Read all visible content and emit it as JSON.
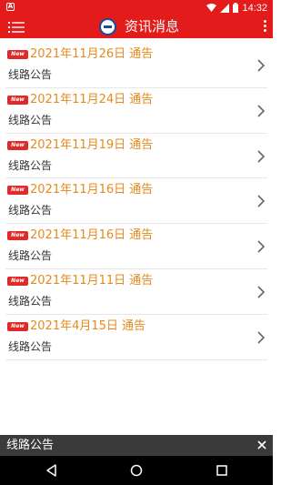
{
  "status_bar": {
    "time": "14:32"
  },
  "app_bar": {
    "title": "资讯消息"
  },
  "colors": {
    "primary": "#e31b1b",
    "title_text": "#e58a1e",
    "badge": "#e02a2a"
  },
  "items": [
    {
      "badge": "New",
      "title": "2021年11月26日  通告",
      "subtitle": "线路公告"
    },
    {
      "badge": "New",
      "title": "2021年11月24日  通告",
      "subtitle": "线路公告"
    },
    {
      "badge": "New",
      "title": "2021年11月19日  通告",
      "subtitle": "线路公告"
    },
    {
      "badge": "New",
      "title": "2021年11月16日  通告",
      "subtitle": "线路公告"
    },
    {
      "badge": "New",
      "title": "2021年11月16日  通告",
      "subtitle": "线路公告"
    },
    {
      "badge": "New",
      "title": "2021年11月11日  通告",
      "subtitle": "线路公告"
    },
    {
      "badge": "New",
      "title": "2021年4月15日  通告",
      "subtitle": "线路公告"
    }
  ],
  "bottom_bar": {
    "text": "线路公告"
  },
  "icons": {
    "menu": "menu-icon",
    "logo": "logo-icon",
    "more": "more-icon",
    "chevron": "chevron-right-icon",
    "close": "close-icon",
    "back": "back-icon",
    "home": "home-icon",
    "recents": "recents-icon"
  }
}
